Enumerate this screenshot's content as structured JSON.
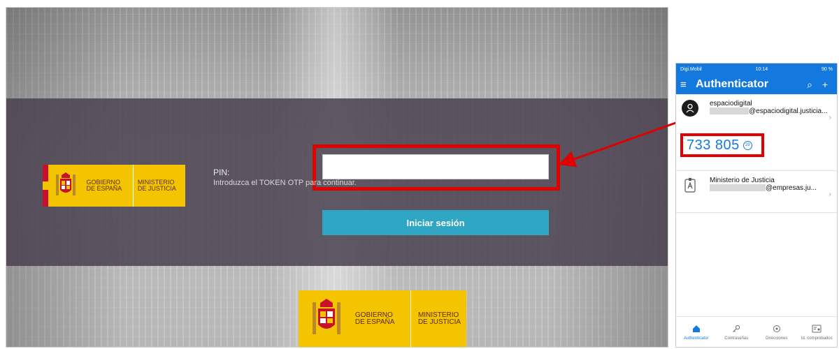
{
  "login": {
    "pin_label": "PIN:",
    "pin_value": "",
    "otp_hint": "Introduzca el TOKEN OTP para continuar.",
    "submit_label": "Iniciar sesión"
  },
  "logo": {
    "gobierno": [
      "GOBIERNO",
      "DE ESPAÑA"
    ],
    "ministerio": [
      "MINISTERIO",
      "DE JUSTICIA"
    ]
  },
  "phone": {
    "status": {
      "carrier": "Digi.Mobil",
      "time": "10:14",
      "battery": "90 %"
    },
    "app_title": "Authenticator",
    "accounts": [
      {
        "name": "espaciodigital",
        "email_suffix": "@espaciodigital.justicia...",
        "code": "733 805",
        "timer": "29"
      },
      {
        "name": "Ministerio de Justicia",
        "email_suffix": "@empresas.ju..."
      }
    ],
    "tabs": [
      {
        "label": "Authenticator",
        "icon": "home-icon"
      },
      {
        "label": "Contraseñas",
        "icon": "key-icon"
      },
      {
        "label": "Direcciones",
        "icon": "location-icon"
      },
      {
        "label": "Id. comprobados",
        "icon": "id-card-icon"
      }
    ]
  },
  "colors": {
    "accent_red": "#e00000",
    "button_teal": "#2fa6c3",
    "authenticator_blue": "#1479de",
    "gov_yellow": "#f4c400"
  }
}
